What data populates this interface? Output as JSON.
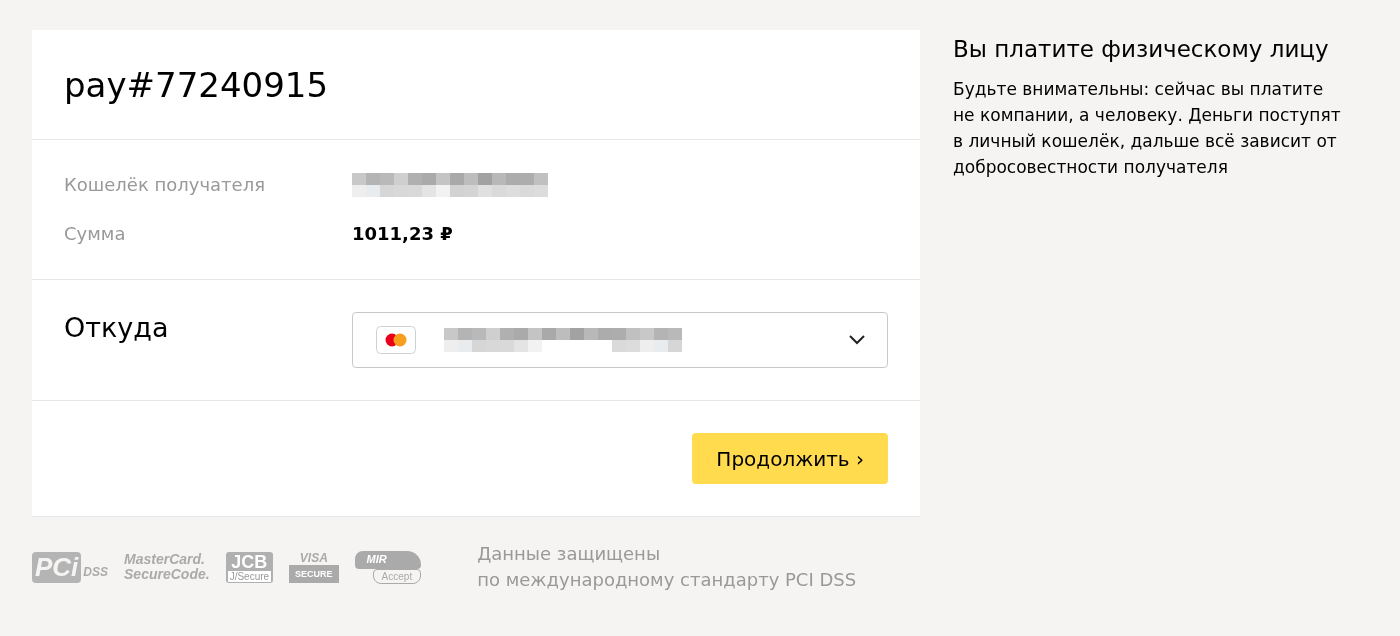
{
  "payment": {
    "title": "pay#77240915",
    "details": [
      {
        "label": "Кошелёк получателя",
        "kind": "hidden"
      },
      {
        "label": "Сумма",
        "kind": "text",
        "value": "1011,23 ₽"
      }
    ],
    "source": {
      "label": "Откуда",
      "card": {
        "kind": "mastercard"
      }
    },
    "button": "Продолжить ›"
  },
  "security": {
    "logos": [
      {
        "kind": "pci",
        "texts": [
          "PCi",
          "DSS"
        ]
      },
      {
        "kind": "mastercard",
        "texts": [
          "MasterCard.",
          "SecureCode."
        ]
      },
      {
        "kind": "jcb",
        "texts": [
          "JCB",
          "J/Secure"
        ]
      },
      {
        "kind": "visa",
        "texts": [
          "VISA",
          "SECURE"
        ]
      },
      {
        "kind": "mir",
        "texts": [
          "MIR",
          "Accept"
        ]
      }
    ],
    "note": [
      "Данные защищены",
      "по международному стандарту PCI DSS"
    ]
  },
  "aside": {
    "title": "Вы платите физическому лицу",
    "text": "Будьте внимательны: сейчас вы платите не компании, а человеку. Деньги поступят в личный кошелёк, дальше всё зависит от добросовестности получателя"
  }
}
